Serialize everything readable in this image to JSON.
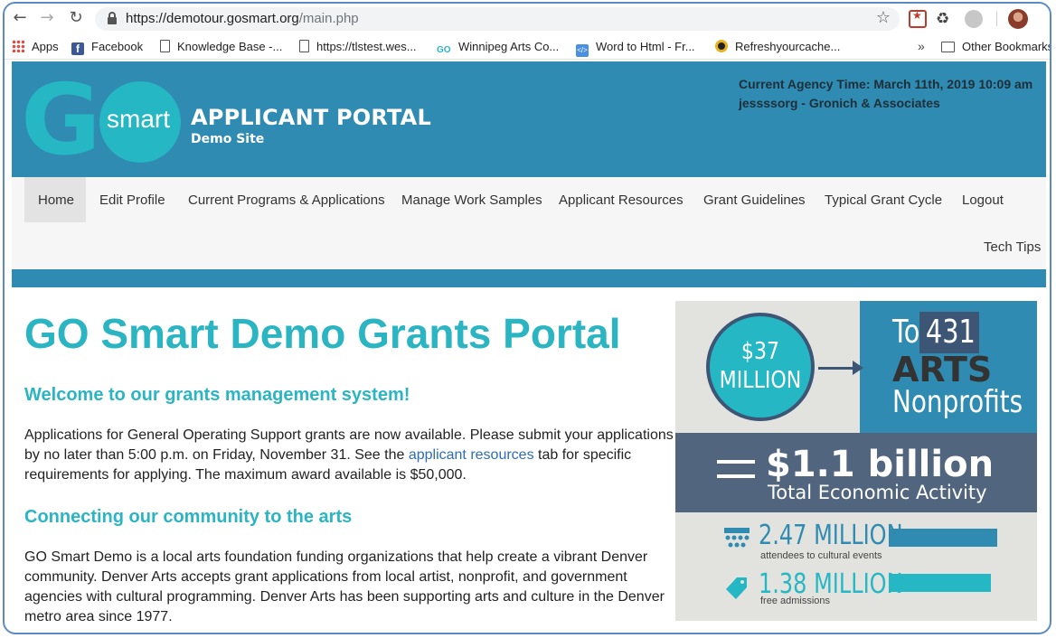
{
  "browser": {
    "url_host": "https://demotour.gosmart.org",
    "url_path": "/main.php",
    "bookmarks": [
      {
        "label": "Apps",
        "icon": "apps-grid-icon"
      },
      {
        "label": "Facebook",
        "icon": "facebook-icon"
      },
      {
        "label": "Knowledge Base -...",
        "icon": "page-icon"
      },
      {
        "label": "https://tlstest.wes...",
        "icon": "page-icon"
      },
      {
        "label": "Winnipeg Arts Co...",
        "icon": "gosmart-icon"
      },
      {
        "label": "Word to Html - Fr...",
        "icon": "code-icon"
      },
      {
        "label": "Refreshyourcache...",
        "icon": "refresh-site-icon"
      }
    ],
    "more_label": "»",
    "other_bookmarks": "Other Bookmarks"
  },
  "header": {
    "logo_go": "G",
    "logo_smart": "smart",
    "portal_title": "APPLICANT PORTAL",
    "portal_subtitle": "Demo Site",
    "agency_time": "Current Agency Time: March 11th, 2019 10:09 am",
    "agency_org": "jessssorg - Gronich & Associates",
    "colors": {
      "header_bg": "#2f8bb1",
      "accent": "#2bb5c2"
    }
  },
  "nav": {
    "items": [
      "Home",
      "Edit Profile",
      "Current Programs & Applications",
      "Manage Work Samples",
      "Applicant Resources",
      "Grant Guidelines",
      "Typical Grant Cycle",
      "Logout"
    ],
    "second_row": "Tech Tips",
    "active": "Home"
  },
  "content": {
    "title": "GO Smart Demo Grants Portal",
    "welcome_heading": "Welcome to our grants management system!",
    "welcome_text_before": "Applications for General Operating Support grants are now available. Please submit your applications by no later than 5:00 p.m. on Friday, November 31. See the ",
    "welcome_link": "applicant resources",
    "welcome_text_after": " tab for specific requirements for applying. The maximum award available is $50,000.",
    "community_heading": "Connecting our community to the arts",
    "community_text": "GO Smart Demo is a local arts foundation funding organizations that help create a vibrant Denver community. Denver Arts accepts grant applications from local artist, nonprofit, and government agencies with cultural programming. Denver Arts has been supporting arts and culture in the Denver metro area since 1977."
  },
  "infographic": {
    "circle_line1": "$37",
    "circle_line2": "MILLION",
    "to_label": "To",
    "count": "431",
    "arts_label": "ARTS",
    "nonprofits_label": "Nonprofits",
    "billion": "$1.1 billion",
    "economic": "Total Economic Activity",
    "stat1_big": "2.47 MILLION",
    "stat1_small": "attendees to cultural events",
    "stat2_big": "1.38 MILLION",
    "stat2_small": "free admissions",
    "stat1_bar_fraction": 1.0,
    "stat2_bar_fraction": 0.94,
    "colors": {
      "teal": "#25b7c3",
      "blue": "#2f8bb1",
      "slate": "#52657f",
      "navy": "#3e5676"
    }
  }
}
